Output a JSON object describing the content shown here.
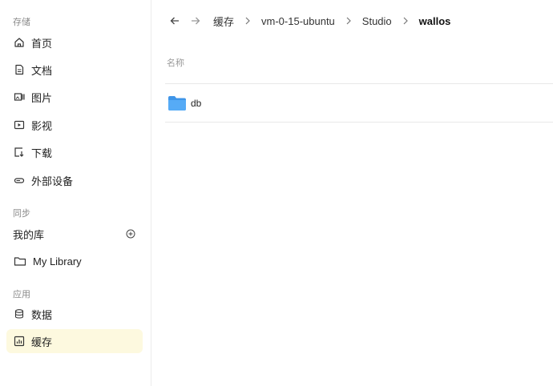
{
  "sidebar": {
    "section_storage": "存储",
    "items": [
      {
        "label": "首页",
        "icon": "home-icon"
      },
      {
        "label": "文档",
        "icon": "document-icon"
      },
      {
        "label": "图片",
        "icon": "image-icon"
      },
      {
        "label": "影视",
        "icon": "video-icon"
      },
      {
        "label": "下载",
        "icon": "download-icon"
      },
      {
        "label": "外部设备",
        "icon": "external-drive-icon"
      }
    ],
    "section_sync": "同步",
    "my_library": "我的库",
    "library_item": "My Library",
    "section_apps": "应用",
    "app_items": [
      {
        "label": "数据",
        "icon": "database-icon"
      },
      {
        "label": "缓存",
        "icon": "cache-icon",
        "active": true
      }
    ]
  },
  "breadcrumb": {
    "items": [
      "缓存",
      "vm-0-15-ubuntu",
      "Studio",
      "wallos"
    ]
  },
  "list": {
    "column_name": "名称",
    "files": [
      {
        "name": "db",
        "type": "folder"
      }
    ]
  },
  "colors": {
    "active_bg": "#fdf9df",
    "folder": "#4fa6f5"
  }
}
